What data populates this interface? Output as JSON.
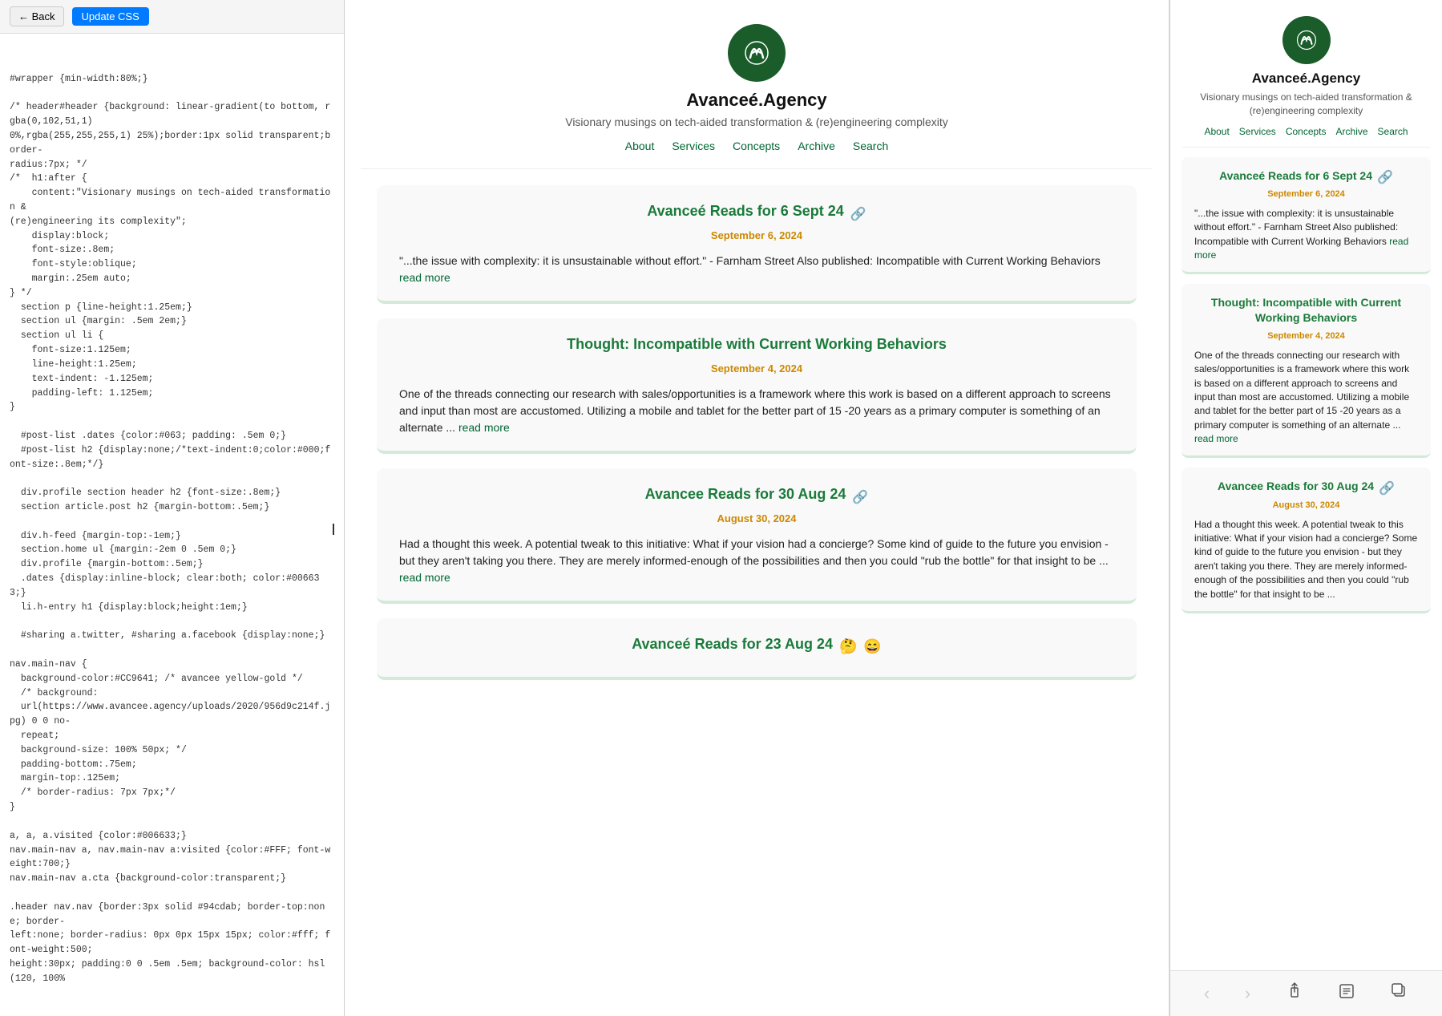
{
  "toolbar": {
    "back_label": "← Back",
    "update_css_label": "Update CSS"
  },
  "code_editor": {
    "content": "#wrapper {min-width:80%;}\n\n/* header#header {background: linear-gradient(to bottom, rgba(0,102,51,1)\n0%,rgba(255,255,255,1) 25%);border:1px solid transparent;border-\nradius:7px; */\n/*  h1:after {\n    content:\"Visionary musings on tech-aided transformation &\n(re)engineering its complexity\";\n    display:block;\n    font-size:.8em;\n    font-style:oblique;\n    margin:.25em auto;\n} */\n  section p {line-height:1.25em;}\n  section ul {margin: .5em 2em;}\n  section ul li {\n    font-size:1.125em;\n    line-height:1.25em;\n    text-indent: -1.125em;\n    padding-left: 1.125em;\n}\n\n  #post-list .dates {color:#063; padding: .5em 0;}\n  #post-list h2 {display:none;/*text-indent:0;color:#000;font-size:.8em;*/}\n\n  div.profile section header h2 {font-size:.8em;}\n  section article.post h2 {margin-bottom:.5em;}\n\n  div.h-feed {margin-top:-1em;}\n  section.home ul {margin:-2em 0 .5em 0;}\n  div.profile {margin-bottom:.5em;}\n  .dates {display:inline-block; clear:both; color:#006633;}\n  li.h-entry h1 {display:block;height:1em;}\n\n  #sharing a.twitter, #sharing a.facebook {display:none;}\n\nnav.main-nav {\n  background-color:#CC9641; /* avancee yellow-gold */\n  /* background:\n  url(https://www.avancee.agency/uploads/2020/956d9c214f.jpg) 0 0 no-\n  repeat;\n  background-size: 100% 50px; */\n  padding-bottom:.75em;\n  margin-top:.125em;\n  /* border-radius: 7px 7px;*/\n}\n\na, a, a.visited {color:#006633;}\nnav.main-nav a, nav.main-nav a:visited {color:#FFF; font-weight:700;}\nnav.main-nav a.cta {background-color:transparent;}\n\n.header nav.nav {border:3px solid #94cdab; border-top:none; border-\nleft:none; border-radius: 0px 0px 15px 15px; color:#fff; font-weight:500;\nheight:30px; padding:0 0 .5em .5em; background-color: hsl(120, 100%"
  },
  "site": {
    "title": "Avanceé.Agency",
    "tagline": "Visionary musings on tech-aided transformation & (re)engineering complexity",
    "nav": {
      "items": [
        "About",
        "Services",
        "Concepts",
        "Archive",
        "Search"
      ]
    },
    "posts": [
      {
        "title": "Avanceé Reads for 6 Sept 24",
        "has_link_icon": true,
        "date": "September 6, 2024",
        "excerpt": "\"...the issue with complexity: it is unsustainable without effort.\" - Farnham Street Also published: Incompatible with Current Working Behaviors",
        "read_more": "read more"
      },
      {
        "title": "Thought: Incompatible with Current Working Behaviors",
        "has_link_icon": false,
        "date": "September 4, 2024",
        "excerpt": "One of the threads connecting our research with sales/opportunities is a framework where this work is based on a different approach to screens and input than most are accustomed. Utilizing a mobile and tablet for the better part of 15 -20 years as a primary computer is something of an alternate ...",
        "read_more": "read more"
      },
      {
        "title": "Avancee Reads for 30 Aug 24",
        "has_link_icon": true,
        "date": "August 30, 2024",
        "excerpt": "Had a thought this week. A potential tweak to this initiative: What if your vision had a concierge? Some kind of guide to the future you envision - but they aren't taking you there. They are merely informed-enough of the possibilities and then you could \"rub the bottle\" for that insight to be ...",
        "read_more": "read more"
      },
      {
        "title": "Avanceé Reads for 23 Aug 24",
        "has_link_icon": false,
        "has_emoji": true,
        "date": "",
        "excerpt": ""
      }
    ]
  },
  "mobile": {
    "site": {
      "title": "Avanceé.Agency",
      "tagline": "Visionary musings on tech-aided transformation & (re)engineering complexity",
      "nav": {
        "items": [
          "About",
          "Services",
          "Concepts",
          "Archive",
          "Search"
        ]
      },
      "posts": [
        {
          "title": "Avanceé Reads for 6 Sept 24",
          "has_link_icon": true,
          "date": "September 6, 2024",
          "excerpt": "\"...the issue with complexity: it is unsustainable without effort.\" - Farnham Street Also published: Incompatible with Current Working Behaviors",
          "read_more": "read more"
        },
        {
          "title": "Thought: Incompatible with Current Working Behaviors",
          "has_link_icon": false,
          "date": "September 4, 2024",
          "excerpt": "One of the threads connecting our research with sales/opportunities is a framework where this work is based on a different approach to screens and input than most are accustomed. Utilizing a mobile and tablet for the better part of 15 -20 years as a primary computer is something of an alternate ...",
          "read_more": "read more"
        },
        {
          "title": "Avancee Reads for 30 Aug 24",
          "has_link_icon": true,
          "date": "August 30, 2024",
          "excerpt": "Had a thought this week. A potential tweak to this initiative: What if your vision had a concierge? Some kind of guide to the future you envision - but they aren't taking you there. They are merely informed-enough of the possibilities and then you could \"rub the bottle\" for that insight to be ...",
          "read_more": "read more"
        }
      ]
    },
    "toolbar": {
      "back": "‹",
      "forward": "›",
      "share": "↑",
      "bookmarks": "📖",
      "tabs": "⧉"
    }
  }
}
